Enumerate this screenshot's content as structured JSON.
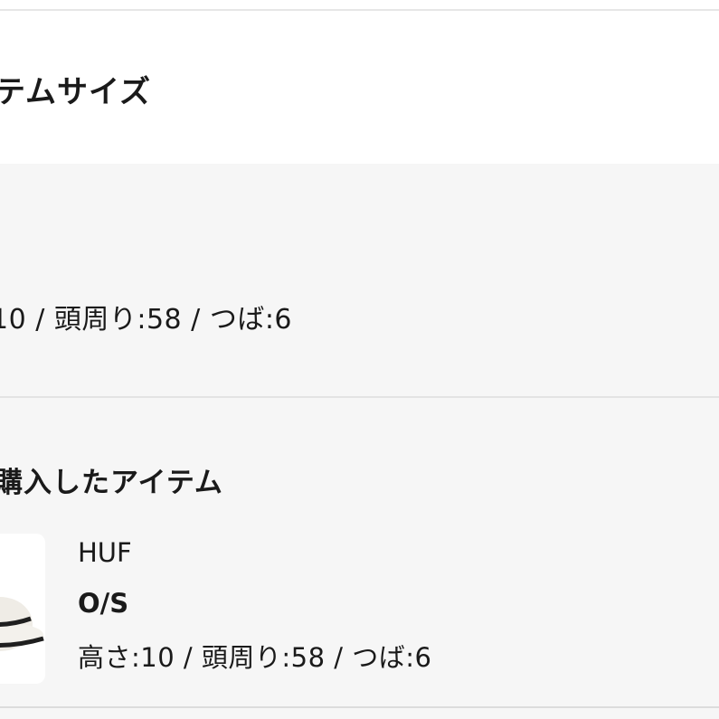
{
  "header": {
    "section_title": "テムサイズ"
  },
  "size_panel": {
    "measurements": "10 / 頭周り:58 / つば:6"
  },
  "purchased": {
    "title": "購入したアイテム",
    "item": {
      "image_icon": "bucket-hat-image",
      "brand": "HUF",
      "size": "O/S",
      "details": "高さ:10 / 頭周り:58 / つば:6"
    }
  },
  "colors": {
    "page_bg": "#ffffff",
    "panel_bg": "#f6f6f6",
    "text": "#1a1a1a",
    "divider": "#e3e3e3"
  }
}
